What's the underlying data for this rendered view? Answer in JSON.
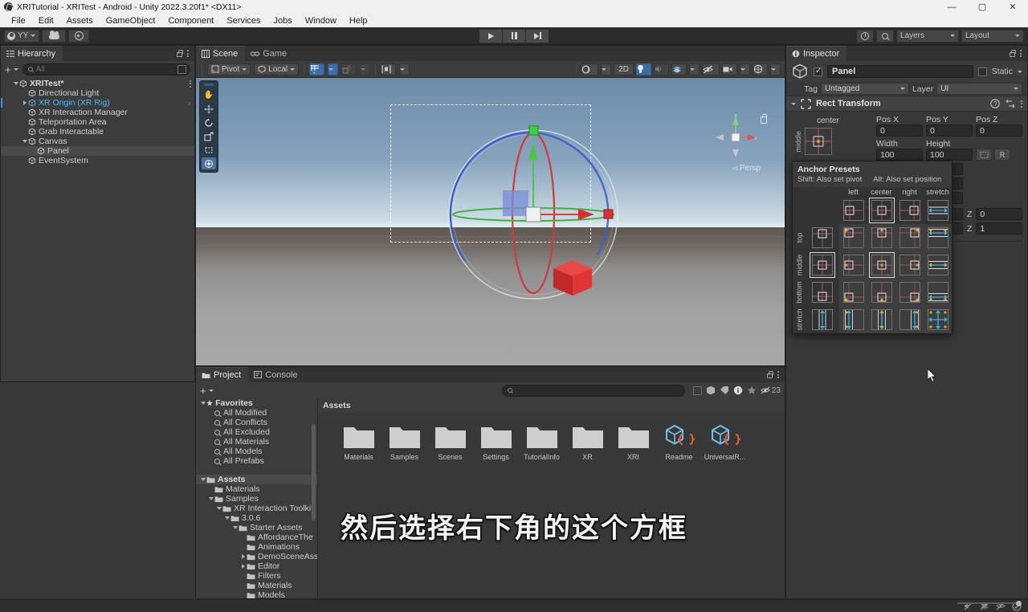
{
  "window": {
    "title": "XRITutorial - XRITest - Android - Unity 2022.3.20f1* <DX11>",
    "minimize": "—",
    "maximize": "▢",
    "close": "✕"
  },
  "menubar": {
    "items": [
      "File",
      "Edit",
      "Assets",
      "GameObject",
      "Component",
      "Services",
      "Jobs",
      "Window",
      "Help"
    ]
  },
  "toolbar": {
    "account_label": "YY",
    "cloud_icon": "cloud-icon",
    "settings_icon": "gear-icon",
    "play_icon": "play-icon",
    "pause_icon": "pause-icon",
    "step_icon": "step-icon",
    "history_icon": "history-icon",
    "search_icon": "search-icon",
    "layers_label": "Layers",
    "layout_label": "Layout"
  },
  "hierarchy": {
    "tab_label": "Hierarchy",
    "search_placeholder": "All",
    "add_label": "+",
    "items": [
      {
        "label": "XRITest*",
        "depth": 0,
        "expanded": true,
        "root": true
      },
      {
        "label": "Directional Light",
        "depth": 1
      },
      {
        "label": "XR Origin (XR Rig)",
        "depth": 1,
        "collapsed": true,
        "highlight": true
      },
      {
        "label": "XR Interaction Manager",
        "depth": 1
      },
      {
        "label": "Teleportation Area",
        "depth": 1
      },
      {
        "label": "Grab Interactable",
        "depth": 1
      },
      {
        "label": "Canvas",
        "depth": 1,
        "expanded": true
      },
      {
        "label": "Panel",
        "depth": 2,
        "selected": true
      },
      {
        "label": "EventSystem",
        "depth": 1
      }
    ]
  },
  "scene": {
    "tabs": [
      {
        "label": "Scene",
        "active": true,
        "icon": "scene-icon"
      },
      {
        "label": "Game",
        "active": false,
        "icon": "game-icon"
      }
    ],
    "pivot_label": "Pivot",
    "local_label": "Local",
    "grid_label": "grid-snapping-icon",
    "view2d_label": "2D",
    "lighting_icon": "lighting-icon",
    "audio_icon": "audio-icon",
    "fx_icon": "fx-icon",
    "hidden_icon": "hidden-objects-icon",
    "camera_icon": "camera-icon",
    "gizmos_icon": "gizmos-icon",
    "perspective_label": "Persp",
    "axis_x": "x",
    "axis_y": "y",
    "tools": [
      "hand-tool",
      "move-tool",
      "rotate-tool",
      "scale-tool",
      "rect-tool",
      "transform-tool"
    ]
  },
  "project": {
    "tabs": [
      {
        "label": "Project",
        "active": true,
        "icon": "folder-icon"
      },
      {
        "label": "Console",
        "active": false,
        "icon": "console-icon"
      }
    ],
    "search_placeholder": "",
    "breadcrumb": "Assets",
    "badge_count": "23",
    "tree": [
      {
        "label": "Favorites",
        "depth": 0,
        "type": "star",
        "expanded": true,
        "header": true
      },
      {
        "label": "All Modified",
        "depth": 1,
        "type": "search"
      },
      {
        "label": "All Conflicts",
        "depth": 1,
        "type": "search"
      },
      {
        "label": "All Excluded",
        "depth": 1,
        "type": "search"
      },
      {
        "label": "All Materials",
        "depth": 1,
        "type": "search"
      },
      {
        "label": "All Models",
        "depth": 1,
        "type": "search"
      },
      {
        "label": "All Prefabs",
        "depth": 1,
        "type": "search"
      },
      {
        "label": "",
        "depth": 0,
        "type": "spacer"
      },
      {
        "label": "Assets",
        "depth": 0,
        "type": "folder",
        "expanded": true,
        "header": true,
        "selected": true
      },
      {
        "label": "Materials",
        "depth": 1,
        "type": "folder"
      },
      {
        "label": "Samples",
        "depth": 1,
        "type": "folder",
        "expanded": true
      },
      {
        "label": "XR Interaction Toolkit",
        "depth": 2,
        "type": "folder",
        "expanded": true
      },
      {
        "label": "3.0.6",
        "depth": 3,
        "type": "folder",
        "expanded": true
      },
      {
        "label": "Starter Assets",
        "depth": 4,
        "type": "folder",
        "expanded": true
      },
      {
        "label": "AffordanceThe",
        "depth": 5,
        "type": "folder"
      },
      {
        "label": "Animations",
        "depth": 5,
        "type": "folder"
      },
      {
        "label": "DemoSceneAss",
        "depth": 5,
        "type": "folder",
        "collapsed": true
      },
      {
        "label": "Editor",
        "depth": 5,
        "type": "folder",
        "collapsed": true
      },
      {
        "label": "Filters",
        "depth": 5,
        "type": "folder"
      },
      {
        "label": "Materials",
        "depth": 5,
        "type": "folder"
      },
      {
        "label": "Models",
        "depth": 5,
        "type": "folder"
      }
    ],
    "assets": [
      {
        "label": "Materials",
        "kind": "folder"
      },
      {
        "label": "Samples",
        "kind": "folder"
      },
      {
        "label": "Scenes",
        "kind": "folder"
      },
      {
        "label": "Settings",
        "kind": "folder"
      },
      {
        "label": "TutorialInfo",
        "kind": "folder"
      },
      {
        "label": "XR",
        "kind": "folder"
      },
      {
        "label": "XRI",
        "kind": "folder"
      },
      {
        "label": "Readme",
        "kind": "asset"
      },
      {
        "label": "UniversalR...",
        "kind": "asset"
      }
    ]
  },
  "inspector": {
    "tab_label": "Inspector",
    "object_name": "Panel",
    "static_label": "Static",
    "tag_label": "Tag",
    "tag_value": "Untagged",
    "layer_label": "Layer",
    "layer_value": "UI",
    "component_title": "Rect Transform",
    "anchor_preset_label": "center",
    "anchor_preset_vlabel": "middle",
    "fields": {
      "pos_x_label": "Pos X",
      "pos_x_value": "0",
      "pos_y_label": "Pos Y",
      "pos_y_value": "0",
      "pos_z_label": "Pos Z",
      "pos_z_value": "0",
      "width_label": "Width",
      "width_value": "100",
      "height_label": "Height",
      "height_value": "100",
      "rot_z_label": "Z",
      "rot_z_value": "0",
      "scale_z_label": "Z",
      "scale_z_value": "1"
    },
    "blueprint_btn": "blueprint-mode-icon",
    "raw_btn": "R"
  },
  "anchor_presets": {
    "title": "Anchor Presets",
    "hint_shift": "Shift: Also set pivot",
    "hint_alt": "Alt: Also set position",
    "col_labels": [
      "left",
      "center",
      "right",
      "stretch"
    ],
    "row_labels": [
      "top",
      "middle",
      "bottom",
      "stretch"
    ],
    "custom_selected_col": "center",
    "custom_selected_row": "middle",
    "hovered_cell": "stretch-stretch"
  },
  "subtitle": {
    "text": "然后选择右下角的这个方框"
  },
  "statusbar": {
    "icons": [
      "mute-audio-icon",
      "layers-status-icon",
      "hidden-status-icon",
      "ok-status-icon"
    ]
  },
  "colors": {
    "accent_blue": "#4a90d9",
    "panel_bg": "#383838",
    "panel_header": "#3c3c3c",
    "red_cube": "#e03535",
    "axis_x": "#e05050",
    "axis_y": "#4fc04f",
    "axis_z": "#4a7fe0",
    "asset_orange": "#e35c39",
    "asset_blue": "#6fc2e8"
  }
}
